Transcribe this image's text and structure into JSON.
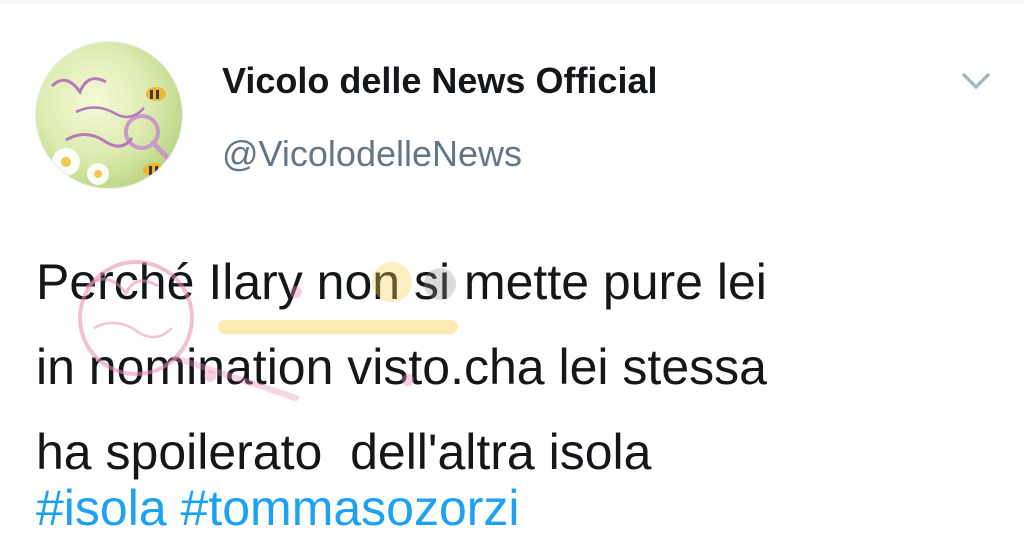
{
  "tweet": {
    "display_name": "Vicolo delle News Official",
    "handle": "@VicolodelleNews",
    "text_lines": [
      "Perché Ilary non si mette pure lei",
      "in nomination visto.cha lei stessa",
      "ha spoilerato  dell'altra isola"
    ],
    "hashtags": [
      "#isola",
      "#tommasozorzi"
    ]
  },
  "icons": {
    "avatar": "vicolo-delle-news-logo",
    "menu": "chevron-down-icon",
    "watermark": "vicolo-delle-news-watermark"
  },
  "colors": {
    "name": "#14171a",
    "handle": "#657786",
    "hashtag": "#1da1f2",
    "chevron": "#aab8c2",
    "watermark": "#e88ab3"
  }
}
